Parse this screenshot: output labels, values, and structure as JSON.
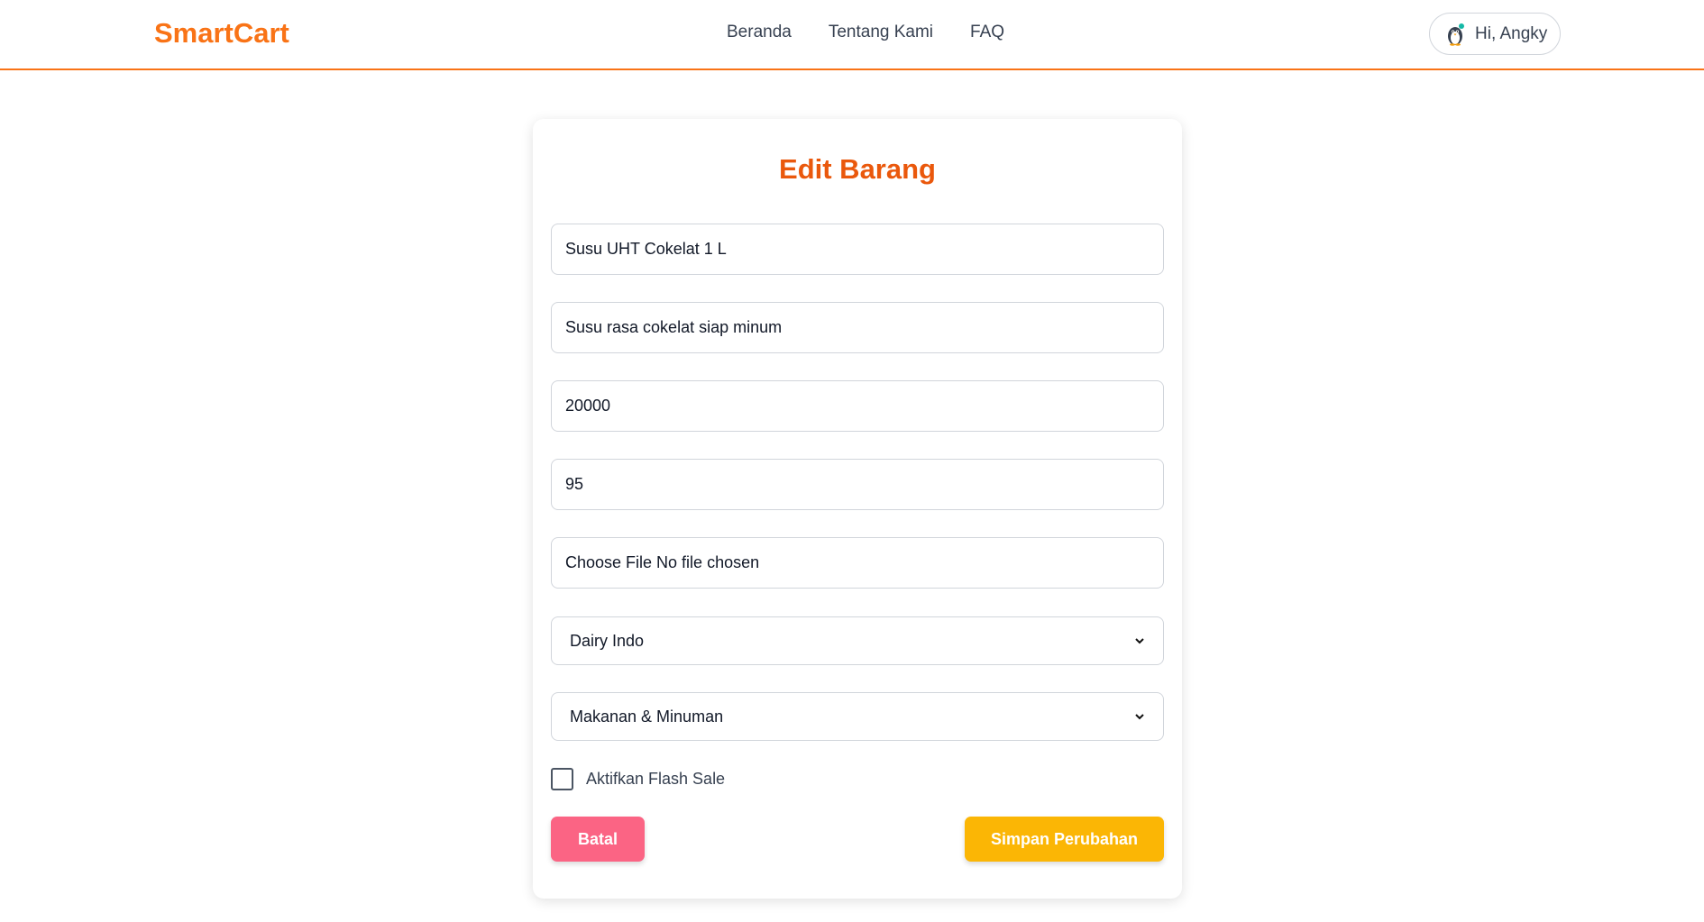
{
  "brand": {
    "name": "SmartCart",
    "color": "#f97316"
  },
  "nav": {
    "links": [
      "Beranda",
      "Tentang Kami",
      "FAQ"
    ]
  },
  "user": {
    "greeting": "Hi, Angky",
    "avatar_icon": "penguin-avatar-icon"
  },
  "form": {
    "title": "Edit Barang",
    "name_value": "Susu UHT Cokelat 1 L",
    "description_value": "Susu rasa cokelat siap minum",
    "price_value": "20000",
    "stock_value": "95",
    "file": {
      "button_label": "Choose File",
      "status": "No file chosen"
    },
    "brand_select": "Dairy Indo",
    "category_select": "Makanan & Minuman",
    "flash_sale_label": "Aktifkan Flash Sale",
    "flash_sale_checked": false,
    "cancel_label": "Batal",
    "save_label": "Simpan Perubahan"
  },
  "colors": {
    "accent": "#f97316",
    "title": "#ea580c",
    "cancel": "#fb6484",
    "save": "#fbb605"
  }
}
